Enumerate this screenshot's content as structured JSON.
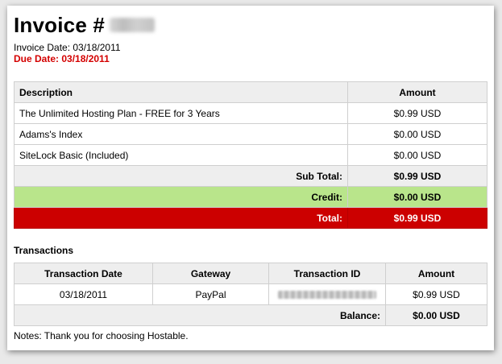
{
  "header": {
    "title": "Invoice #",
    "invoice_date": "Invoice Date: 03/18/2011",
    "due_date": "Due Date: 03/18/2011"
  },
  "items_table": {
    "headers": {
      "description": "Description",
      "amount": "Amount"
    },
    "rows": [
      {
        "description": "The Unlimited Hosting Plan - FREE for 3 Years",
        "amount": "$0.99 USD"
      },
      {
        "description": "Adams's Index",
        "amount": "$0.00 USD"
      },
      {
        "description": "SiteLock Basic (Included)",
        "amount": "$0.00 USD"
      }
    ],
    "subtotal": {
      "label": "Sub Total:",
      "amount": "$0.99 USD"
    },
    "credit": {
      "label": "Credit:",
      "amount": "$0.00 USD"
    },
    "total": {
      "label": "Total:",
      "amount": "$0.99 USD"
    },
    "colors": {
      "credit_bg": "#b9e58b",
      "total_bg": "#cc0000"
    }
  },
  "transactions": {
    "title": "Transactions",
    "headers": {
      "date": "Transaction Date",
      "gateway": "Gateway",
      "id": "Transaction ID",
      "amount": "Amount"
    },
    "rows": [
      {
        "date": "03/18/2011",
        "gateway": "PayPal",
        "amount": "$0.99 USD"
      }
    ],
    "balance": {
      "label": "Balance:",
      "amount": "$0.00 USD"
    }
  },
  "notes": "Notes: Thank you for choosing Hostable.",
  "accent_colors": {
    "due_date": "#d40000"
  }
}
